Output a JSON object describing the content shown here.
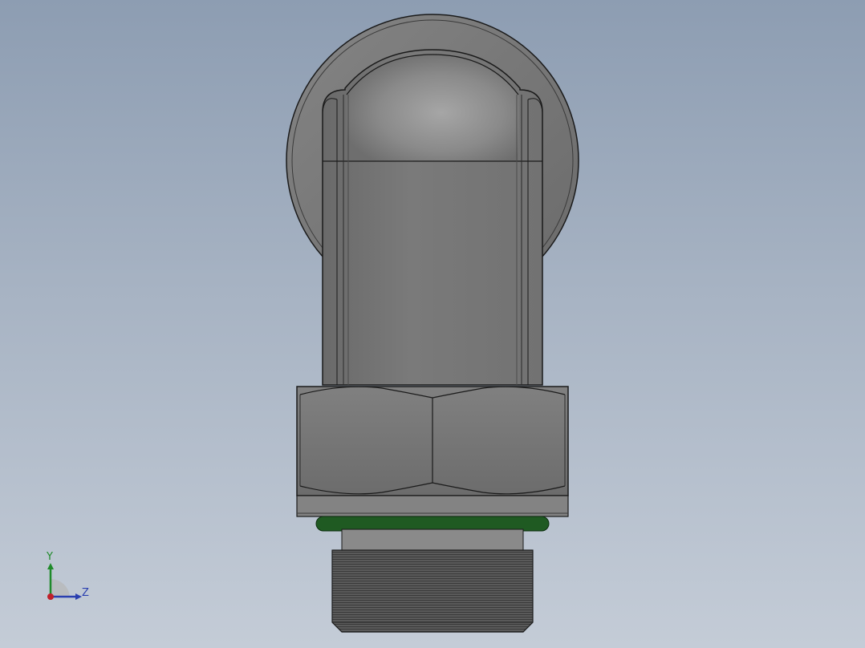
{
  "viewport": {
    "background_top": "#8d9db2",
    "background_bottom": "#c4ccd7"
  },
  "model": {
    "body_color": "#7a7a7a",
    "dome_highlight": "#a6a6a6",
    "edge_color": "#1a1a1a",
    "seal_color": "#1f5a22",
    "thread_color": "#4a4a4a"
  },
  "triad": {
    "y_label": "Y",
    "z_label": "Z",
    "y_color": "#1f8a2a",
    "z_color": "#2a3fb0",
    "x_color": "#c0202a"
  }
}
